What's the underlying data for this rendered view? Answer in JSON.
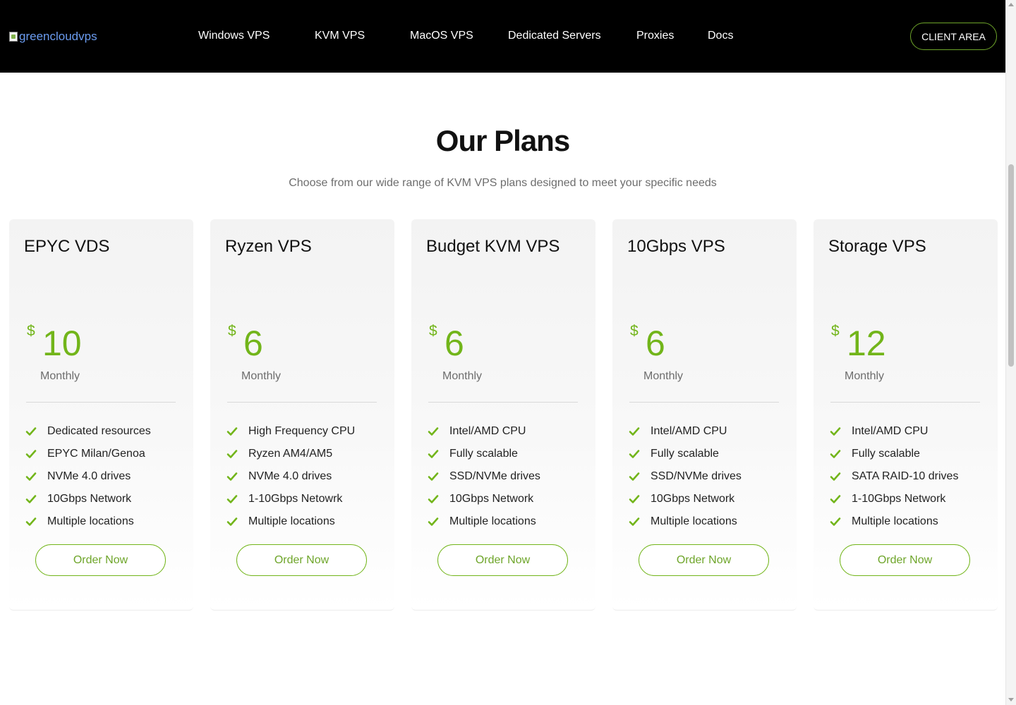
{
  "header": {
    "logo_alt": "greencloudvps",
    "nav": [
      {
        "label": "Windows VPS"
      },
      {
        "label": "KVM VPS"
      },
      {
        "label": "MacOS VPS"
      },
      {
        "label": "Dedicated Servers"
      },
      {
        "label": "Proxies"
      },
      {
        "label": "Docs"
      }
    ],
    "client_area": "CLIENT AREA"
  },
  "section": {
    "title": "Our Plans",
    "subtitle": "Choose from our wide range of KVM VPS plans designed to meet your specific needs"
  },
  "currency_symbol": "$",
  "plans": [
    {
      "name": "EPYC VDS",
      "price": "10",
      "period": "Monthly",
      "features": [
        "Dedicated resources",
        "EPYC Milan/Genoa",
        "NVMe 4.0 drives",
        "10Gbps Network",
        "Multiple locations"
      ],
      "cta": "Order Now"
    },
    {
      "name": "Ryzen VPS",
      "price": "6",
      "period": "Monthly",
      "features": [
        "High Frequency CPU",
        "Ryzen AM4/AM5",
        "NVMe 4.0 drives",
        "1-10Gbps Netowrk",
        "Multiple locations"
      ],
      "cta": "Order Now"
    },
    {
      "name": "Budget KVM VPS",
      "price": "6",
      "period": "Monthly",
      "features": [
        "Intel/AMD CPU",
        "Fully scalable",
        "SSD/NVMe drives",
        "10Gbps Network",
        "Multiple locations"
      ],
      "cta": "Order Now"
    },
    {
      "name": "10Gbps VPS",
      "price": "6",
      "period": "Monthly",
      "features": [
        "Intel/AMD CPU",
        "Fully scalable",
        "SSD/NVMe drives",
        "10Gbps Network",
        "Multiple locations"
      ],
      "cta": "Order Now"
    },
    {
      "name": "Storage VPS",
      "price": "12",
      "period": "Monthly",
      "features": [
        "Intel/AMD CPU",
        "Fully scalable",
        "SATA RAID-10 drives",
        "1-10Gbps Network",
        "Multiple locations"
      ],
      "cta": "Order Now"
    }
  ],
  "icons": {
    "feature": "check-icon",
    "logo": "broken-image-icon"
  },
  "colors": {
    "accent": "#72b51a",
    "header_bg": "#000000",
    "button_border": "#6ea52a"
  }
}
